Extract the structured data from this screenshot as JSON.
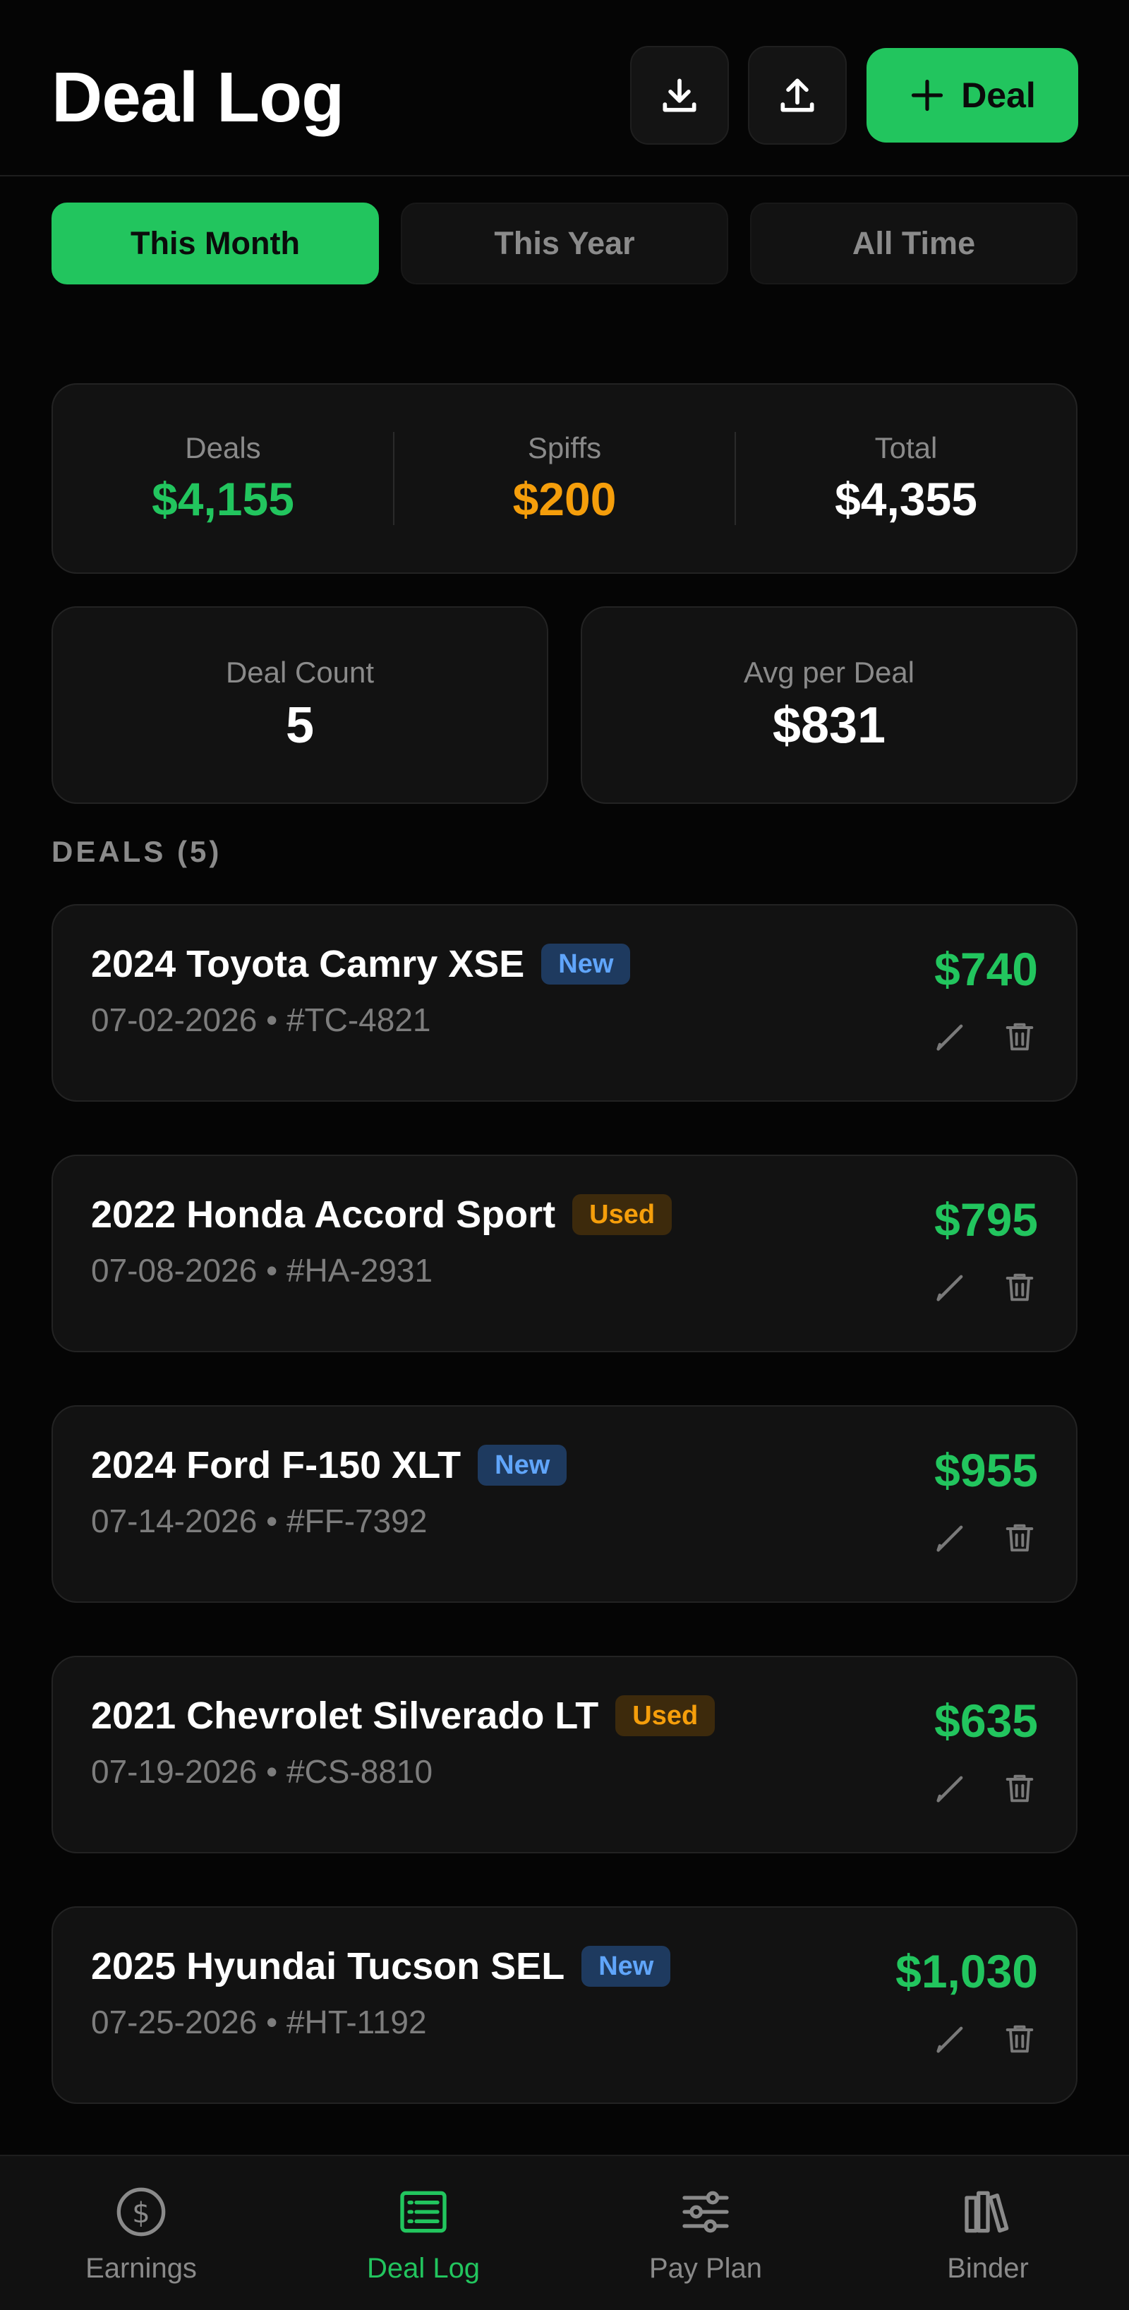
{
  "header": {
    "title": "Deal Log",
    "download_icon": "download-icon",
    "upload_icon": "upload-icon",
    "add_label": "Deal"
  },
  "tabs": [
    {
      "label": "This Month",
      "active": true
    },
    {
      "label": "This Year",
      "active": false
    },
    {
      "label": "All Time",
      "active": false
    }
  ],
  "summary": {
    "deals_label": "Deals",
    "deals_value": "$4,155",
    "spiffs_label": "Spiffs",
    "spiffs_value": "$200",
    "total_label": "Total",
    "total_value": "$4,355"
  },
  "metrics": {
    "count_label": "Deal Count",
    "count_value": "5",
    "avg_label": "Avg per Deal",
    "avg_value": "$831"
  },
  "section_label": "DEALS (5)",
  "deals": [
    {
      "title": "2024 Toyota Camry XSE",
      "badge": "New",
      "meta": "07-02-2026 • #TC-4821",
      "amount": "$740"
    },
    {
      "title": "2022 Honda Accord Sport",
      "badge": "Used",
      "meta": "07-08-2026 • #HA-2931",
      "amount": "$795"
    },
    {
      "title": "2024 Ford F-150 XLT",
      "badge": "New",
      "meta": "07-14-2026 • #FF-7392",
      "amount": "$955"
    },
    {
      "title": "2021 Chevrolet Silverado LT",
      "badge": "Used",
      "meta": "07-19-2026 • #CS-8810",
      "amount": "$635"
    },
    {
      "title": "2025 Hyundai Tucson SEL",
      "badge": "New",
      "meta": "07-25-2026 • #HT-1192",
      "amount": "$1,030"
    }
  ],
  "nav": [
    {
      "label": "Earnings",
      "icon": "dollar-circle-icon",
      "active": false
    },
    {
      "label": "Deal Log",
      "icon": "list-icon",
      "active": true
    },
    {
      "label": "Pay Plan",
      "icon": "sliders-icon",
      "active": false
    },
    {
      "label": "Binder",
      "icon": "books-icon",
      "active": false
    }
  ],
  "colors": {
    "accent": "#22c55e",
    "spiff": "#f59e0b",
    "new_badge": "#60a5fa",
    "used_badge": "#f59e0b",
    "background": "#050505"
  }
}
